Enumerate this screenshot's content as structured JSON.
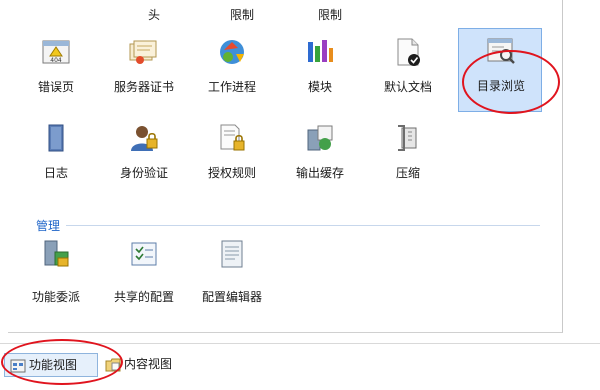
{
  "cutoff_row": {
    "labels": [
      "头",
      "限制",
      "限制"
    ]
  },
  "features": {
    "row1": [
      {
        "label": "错误页",
        "icon": "error-page-icon"
      },
      {
        "label": "服务器证书",
        "icon": "server-certificate-icon"
      },
      {
        "label": "工作进程",
        "icon": "worker-process-icon"
      },
      {
        "label": "模块",
        "icon": "modules-icon"
      },
      {
        "label": "默认文档",
        "icon": "default-document-icon"
      },
      {
        "label": "目录浏览",
        "icon": "directory-browsing-icon"
      }
    ],
    "row2": [
      {
        "label": "日志",
        "icon": "logging-icon"
      },
      {
        "label": "身份验证",
        "icon": "authentication-icon"
      },
      {
        "label": "授权规则",
        "icon": "authorization-rules-icon"
      },
      {
        "label": "输出缓存",
        "icon": "output-caching-icon"
      },
      {
        "label": "压缩",
        "icon": "compression-icon"
      }
    ]
  },
  "management": {
    "title": "管理",
    "items": [
      {
        "label": "功能委派",
        "icon": "feature-delegation-icon"
      },
      {
        "label": "共享的配置",
        "icon": "shared-configuration-icon"
      },
      {
        "label": "配置编辑器",
        "icon": "configuration-editor-icon"
      }
    ]
  },
  "bottom_tabs": {
    "features_view": "功能视图",
    "content_view": "内容视图"
  },
  "colors": {
    "selection": "#cfe3fb",
    "annotation": "#e0141e",
    "section_title": "#1e64c8"
  }
}
